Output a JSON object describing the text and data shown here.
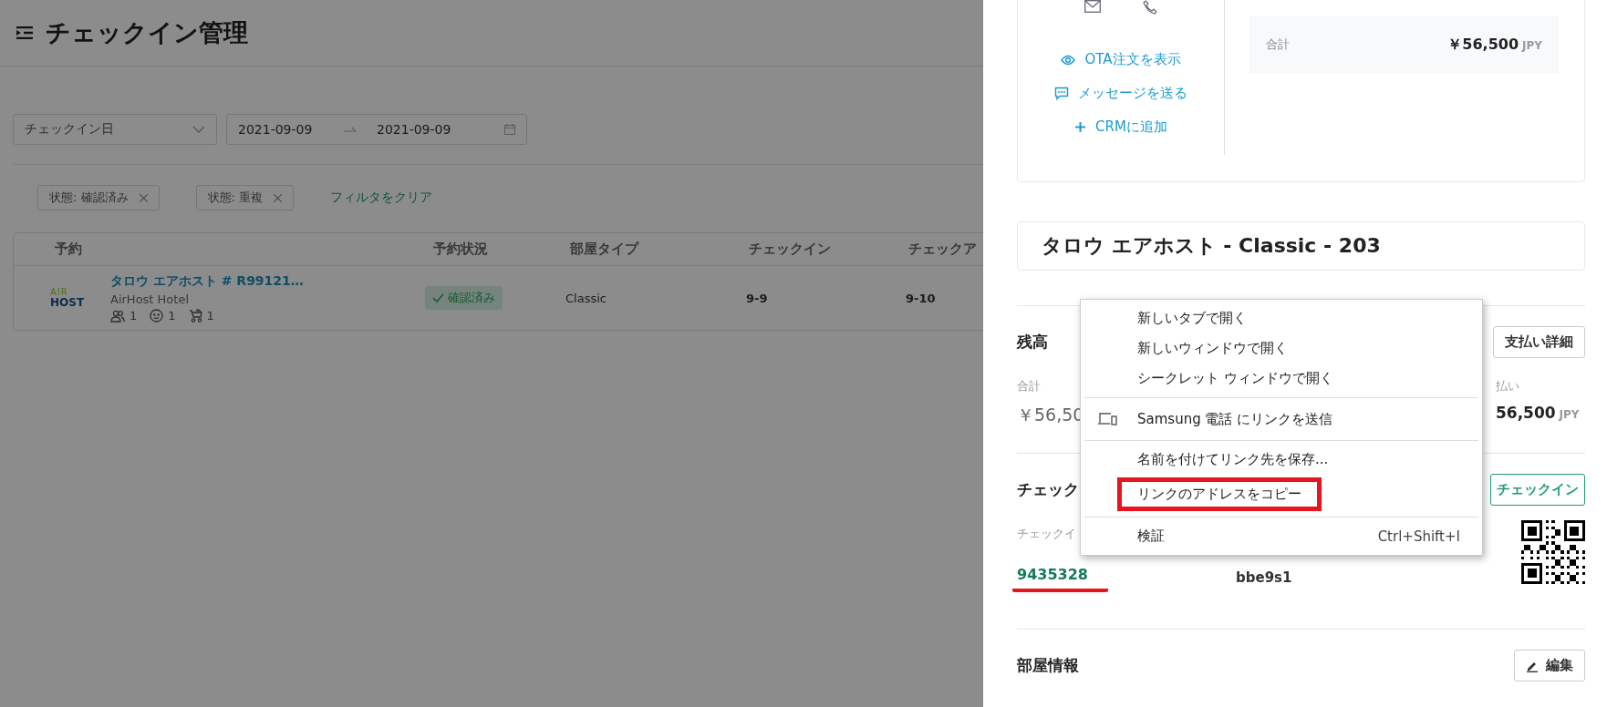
{
  "header": {
    "title": "チェックイン管理"
  },
  "filters": {
    "date_type": {
      "value": "チェックイン日"
    },
    "date_range": {
      "start": "2021-09-09",
      "end": "2021-09-09"
    }
  },
  "active_filters": [
    {
      "label": "状態: 確認済み"
    },
    {
      "label": "状態: 重複"
    }
  ],
  "clear_filters": "フィルタをクリア",
  "table": {
    "columns": [
      "予約",
      "予約状況",
      "部屋タイプ",
      "チェックイン",
      "チェックア"
    ],
    "rows": [
      {
        "logo": [
          "AIR",
          "HOST"
        ],
        "title": "タロウ エアホスト # R99121…",
        "property": "AirHost Hotel",
        "guests": [
          {
            "kind": "adults",
            "count": "1"
          },
          {
            "kind": "children",
            "count": "1"
          },
          {
            "kind": "infants",
            "count": "1"
          }
        ],
        "status": "確認済み",
        "room_type": "Classic",
        "checkin": "9-9",
        "checkout": "9-10"
      }
    ]
  },
  "detail_panel": {
    "contact_actions": [
      {
        "kind": "view",
        "label": "OTA注文を表示"
      },
      {
        "kind": "message",
        "label": "メッセージを送る"
      },
      {
        "kind": "add",
        "label": "CRMに追加"
      }
    ],
    "total": {
      "label": "合計",
      "amount": "￥56,500",
      "currency": "JPY"
    },
    "room_title": "タロウ エアホスト - Classic - 203",
    "balance": {
      "title": "残高",
      "button": "支払い詳細",
      "total_label": "合計",
      "total_amount": "￥56,50",
      "paid_label": "払い",
      "paid_amount": "56,500",
      "paid_currency": "JPY"
    },
    "checkin": {
      "title": "チェック",
      "button": "チェックイン",
      "code_label": "チェックイ",
      "code": "9435328",
      "code_underlined": true,
      "column_2": "bbe9s1"
    },
    "room_info": {
      "title": "部屋情報",
      "button": "編集"
    }
  },
  "context_menu": {
    "groups": [
      [
        {
          "kind": "item",
          "label": "新しいタブで開く",
          "annotated": false
        },
        {
          "kind": "item",
          "label": "新しいウィンドウで開く",
          "annotated": false
        },
        {
          "kind": "item",
          "label": "シークレット ウィンドウで開く",
          "annotated": false
        }
      ],
      [
        {
          "kind": "device",
          "label": "Samsung 電話 にリンクを送信",
          "annotated": false
        }
      ],
      [
        {
          "kind": "item",
          "label": "名前を付けてリンク先を保存...",
          "annotated": false
        },
        {
          "kind": "item",
          "label": "リンクのアドレスをコピー",
          "annotated": true
        }
      ],
      [
        {
          "kind": "item",
          "label": "検証",
          "shortcut": "Ctrl+Shift+I",
          "annotated": false
        }
      ]
    ]
  }
}
